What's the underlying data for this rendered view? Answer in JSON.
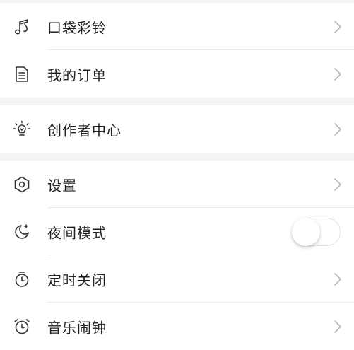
{
  "sections": [
    {
      "items": [
        {
          "icon": "music-note-icon",
          "label": "口袋彩铃",
          "trailing": "chevron"
        },
        {
          "icon": "order-document-icon",
          "label": "我的订单",
          "trailing": "chevron"
        }
      ]
    },
    {
      "items": [
        {
          "icon": "lightbulb-icon",
          "label": "创作者中心",
          "trailing": "chevron"
        }
      ]
    },
    {
      "items": [
        {
          "icon": "hexagon-settings-icon",
          "label": "设置",
          "trailing": "chevron"
        },
        {
          "icon": "moon-star-icon",
          "label": "夜间模式",
          "trailing": "toggle",
          "toggle_on": false
        },
        {
          "icon": "timer-icon",
          "label": "定时关闭",
          "trailing": "chevron"
        },
        {
          "icon": "alarm-clock-icon",
          "label": "音乐闹钟",
          "trailing": "chevron"
        }
      ]
    }
  ],
  "colors": {
    "background": "#f5f5f5",
    "card": "#ffffff",
    "text": "#222222",
    "divider": "#ebebeb",
    "chevron": "#b8b8b8",
    "icon": "#333333"
  }
}
